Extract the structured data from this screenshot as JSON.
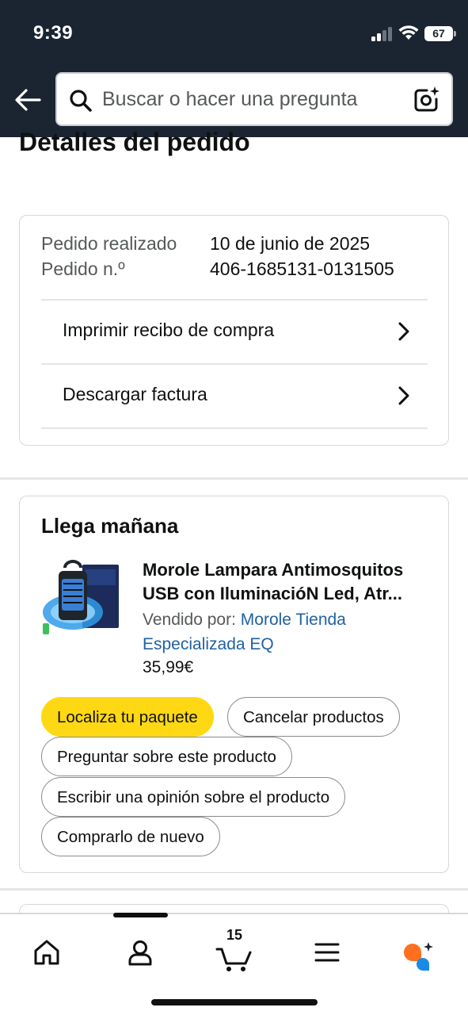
{
  "status_bar": {
    "time": "9:39",
    "battery": "67"
  },
  "search": {
    "placeholder": "Buscar o hacer una pregunta"
  },
  "page": {
    "title": "Detalles del pedido"
  },
  "order": {
    "placed_label": "Pedido realizado",
    "placed_value": "10 de junio de 2025",
    "number_label": "Pedido n.º",
    "number_value": "406-1685131-0131505",
    "links": [
      {
        "label": "Imprimir recibo de compra"
      },
      {
        "label": "Descargar factura"
      }
    ]
  },
  "delivery": {
    "title": "Llega mañana",
    "product": {
      "name_line1": "Morole Lampara Antimosquitos",
      "name_line2": "USB con IluminacióN Led, Atr...",
      "sold_by_label": "Vendido por:",
      "seller": "Morole Tienda Especializada EQ",
      "price": "35,99€"
    },
    "actions": {
      "track": "Localiza tu paquete",
      "cancel": "Cancelar productos",
      "ask": "Preguntar sobre este producto",
      "review": "Escribir una opinión sobre el producto",
      "buy_again": "Comprarlo de nuevo"
    }
  },
  "bottom_nav": {
    "items": [
      {
        "icon": "home-icon"
      },
      {
        "icon": "account-icon"
      },
      {
        "icon": "cart-icon",
        "badge": "15"
      },
      {
        "icon": "menu-icon"
      },
      {
        "icon": "rufus-ai-icon"
      }
    ]
  },
  "colors": {
    "header_bg": "#1b2431",
    "primary_button": "#ffd814",
    "link": "#2162a1"
  }
}
